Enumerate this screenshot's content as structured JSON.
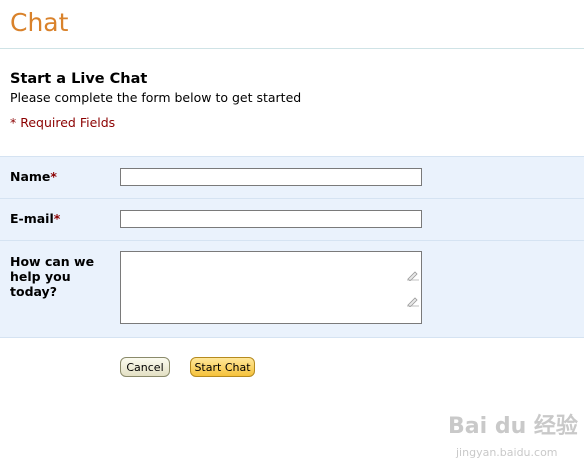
{
  "page": {
    "title": "Chat"
  },
  "form": {
    "heading": "Start a Live Chat",
    "intro": "Please complete the form below to get started",
    "required_note": "* Required Fields",
    "required_marker": "*",
    "fields": {
      "name": {
        "label": "Name",
        "value": ""
      },
      "email": {
        "label": "E-mail",
        "value": ""
      },
      "question": {
        "label_lines": [
          "How can we",
          "help you",
          "today?"
        ],
        "value": ""
      }
    },
    "buttons": {
      "cancel": "Cancel",
      "start": "Start Chat"
    }
  },
  "watermark": {
    "text": "Bai du 经验",
    "subtext": "jingyan.baidu.com"
  },
  "colors": {
    "title": "#d9822b",
    "required": "#8b0000",
    "form_background": "#eaf2fc",
    "start_button": "#f5c23c"
  },
  "icons": [
    "resize-grip-icon",
    "edit-pencil-icon"
  ]
}
